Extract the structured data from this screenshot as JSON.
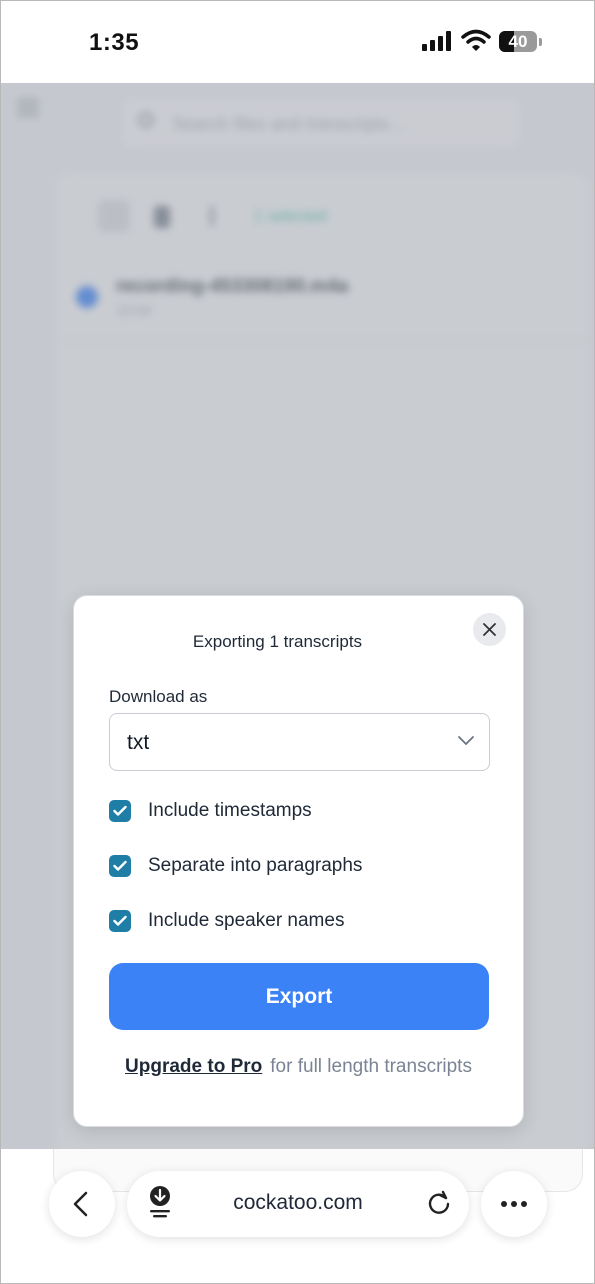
{
  "status_bar": {
    "time": "1:35",
    "battery": "40",
    "battery_level": 0.4
  },
  "background_app": {
    "search_placeholder": "Search files and transcripts...",
    "selected_label": "1 selected",
    "file_name": "recording-453308190.m4a",
    "file_duration": "10:04"
  },
  "modal": {
    "title": "Exporting 1 transcripts",
    "download_label": "Download as",
    "format_value": "txt",
    "options": [
      {
        "label": "Include timestamps",
        "checked": true
      },
      {
        "label": "Separate into paragraphs",
        "checked": true
      },
      {
        "label": "Include speaker names",
        "checked": true
      }
    ],
    "export_label": "Export",
    "upgrade_link": "Upgrade to Pro",
    "upgrade_text": "for full length transcripts"
  },
  "browser": {
    "url": "cockatoo.com"
  },
  "colors": {
    "accent": "#3b82f6",
    "checkbox": "#1f7ea6",
    "teal_text": "#46c2a4"
  },
  "icons": [
    "signal-icon",
    "wifi-icon",
    "battery-icon",
    "menu-icon",
    "search-icon",
    "download-icon",
    "trash-icon",
    "close-icon",
    "chevron-down-icon",
    "check-icon",
    "back-icon",
    "reload-icon",
    "more-icon"
  ]
}
